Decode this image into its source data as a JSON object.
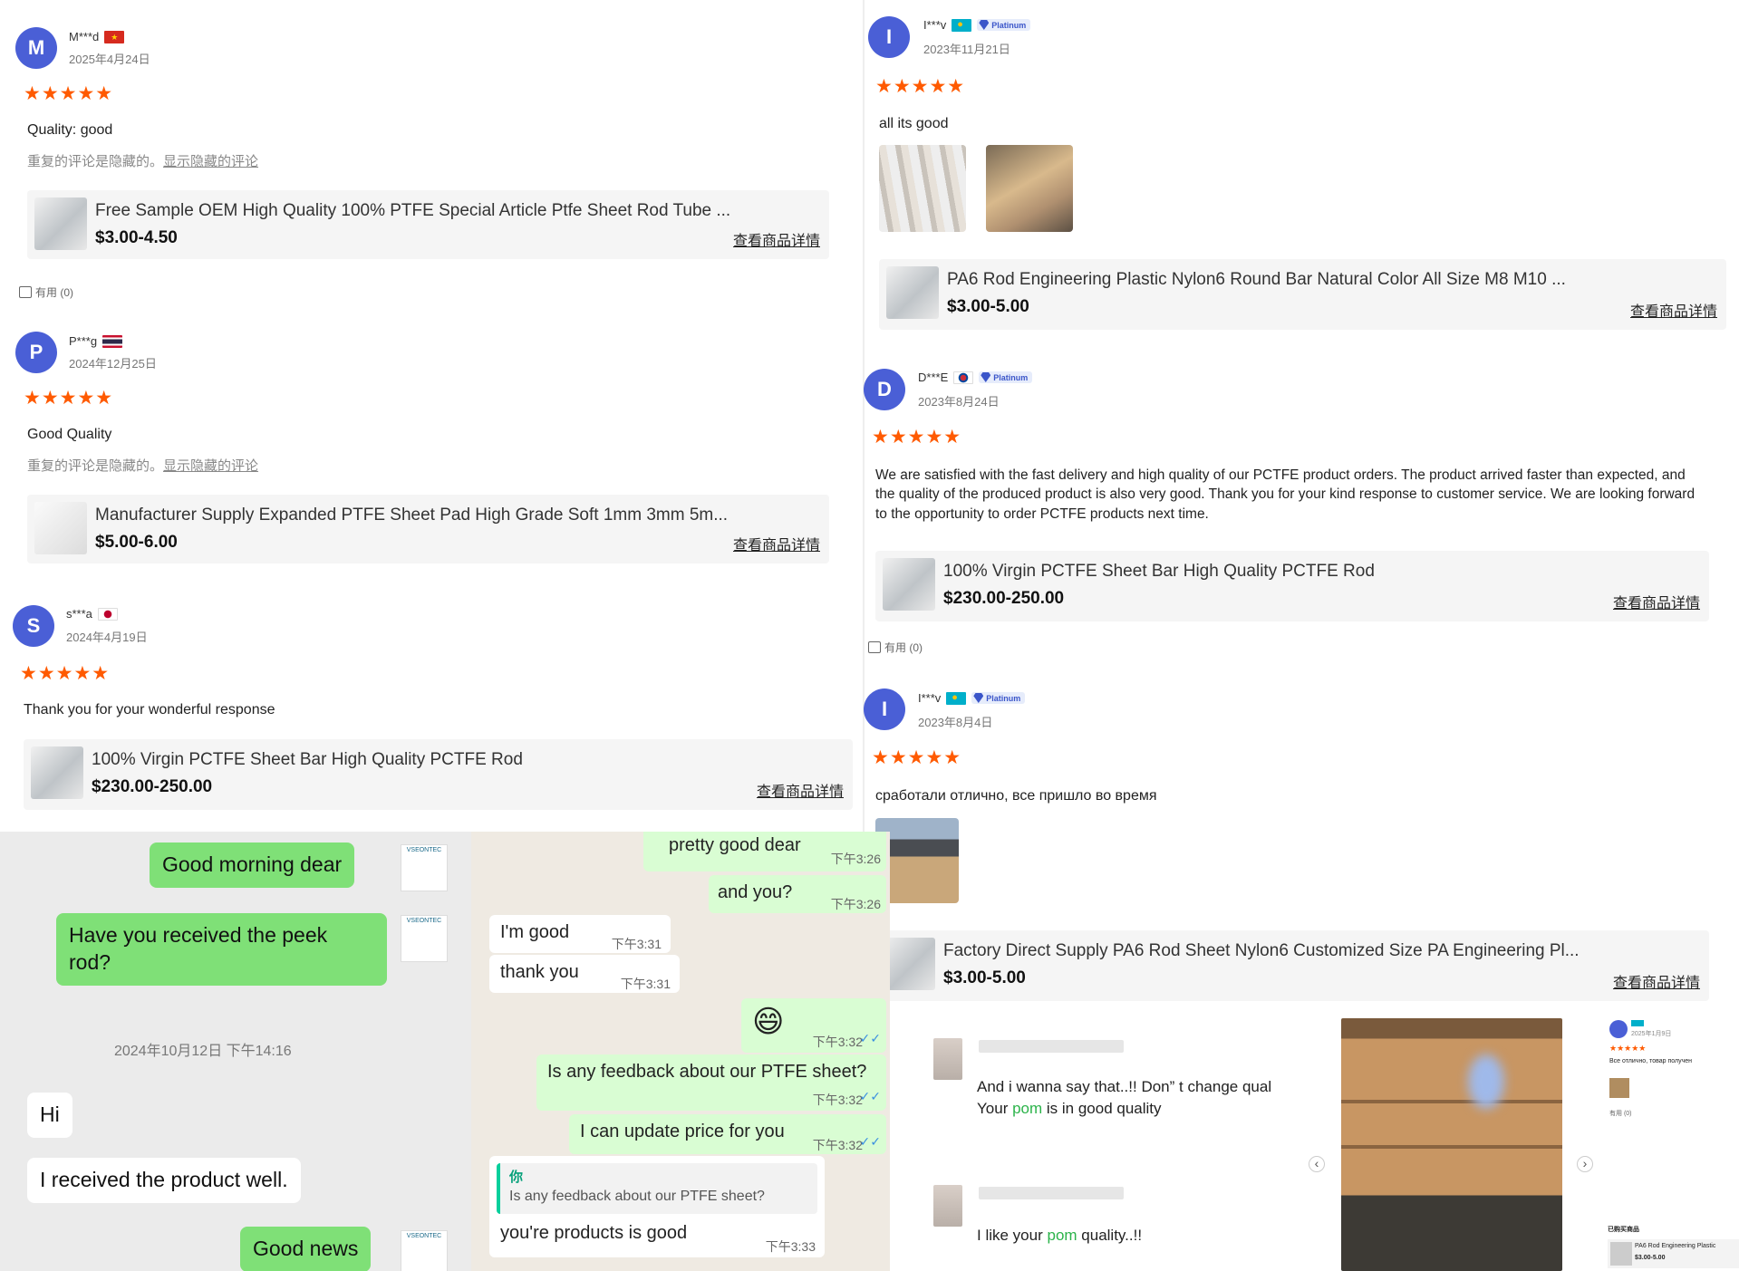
{
  "left_reviews": [
    {
      "initial": "M",
      "user": "M***d",
      "flag": "flag-vietnam",
      "date": "2025年4月24日",
      "stars": "★★★★★",
      "text": "Quality: good",
      "hidden_note": "重复的评论是隐藏的。",
      "hidden_link": "显示隐藏的评论",
      "product": {
        "title": "Free Sample OEM High Quality 100% PTFE Special Article Ptfe Sheet Rod Tube ...",
        "price": "$3.00-4.50",
        "detail": "查看商品详情"
      },
      "useful": "有用 (0)"
    },
    {
      "initial": "P",
      "user": "P***g",
      "flag": "flag-thailand",
      "date": "2024年12月25日",
      "stars": "★★★★★",
      "text": "Good Quality",
      "hidden_note": "重复的评论是隐藏的。",
      "hidden_link": "显示隐藏的评论",
      "product": {
        "title": "Manufacturer Supply Expanded PTFE Sheet Pad High Grade Soft 1mm 3mm 5m...",
        "price": "$5.00-6.00",
        "detail": "查看商品详情"
      }
    },
    {
      "initial": "S",
      "user": "s***a",
      "flag": "flag-japan",
      "date": "2024年4月19日",
      "stars": "★★★★★",
      "text": "Thank you for your wonderful response",
      "product": {
        "title": "100% Virgin PCTFE Sheet Bar High Quality PCTFE Rod",
        "price": "$230.00-250.00",
        "detail": "查看商品详情"
      }
    }
  ],
  "right_reviews": [
    {
      "initial": "I",
      "user": "I***v",
      "flag": "flag-kazakhstan",
      "badge": "Platinum",
      "date": "2023年11月21日",
      "stars": "★★★★★",
      "text": "all its good",
      "product": {
        "title": "PA6 Rod Engineering Plastic Nylon6 Round Bar Natural Color All Size M8 M10 ...",
        "price": "$3.00-5.00",
        "detail": "查看商品详情"
      }
    },
    {
      "initial": "D",
      "user": "D***E",
      "flag": "flag-south-korea",
      "badge": "Platinum",
      "date": "2023年8月24日",
      "stars": "★★★★★",
      "text": "We are satisfied with the fast delivery and high quality of our PCTFE product orders. The product arrived faster than expected, and the quality of the produced product is also very good. Thank you for your kind response to customer service. We are looking forward to the opportunity to order PCTFE products next time.",
      "product": {
        "title": "100% Virgin PCTFE Sheet Bar High Quality PCTFE Rod",
        "price": "$230.00-250.00",
        "detail": "查看商品详情"
      },
      "useful": "有用 (0)"
    },
    {
      "initial": "I",
      "user": "I***v",
      "flag": "flag-kazakhstan",
      "badge": "Platinum",
      "date": "2023年8月4日",
      "stars": "★★★★★",
      "text": "сработали отлично, все пришло во время",
      "product": {
        "title": "Factory Direct Supply PA6 Rod Sheet Nylon6 Customized Size PA Engineering Pl...",
        "price": "$3.00-5.00",
        "detail": "查看商品详情"
      }
    }
  ],
  "chat_left": {
    "msg1": "Good morning dear",
    "msg2": "Have you received the peek rod?",
    "date_divider": "2024年10月12日 下午14:16",
    "msg3": "Hi",
    "msg4": "I received the product well.",
    "msg5": "Good news"
  },
  "chat_mid": {
    "m1": "pretty good dear",
    "t1": "下午3:26",
    "m2": "and you?",
    "t2": "下午3:26",
    "m3": "I'm good",
    "t3": "下午3:31",
    "m4": "thank you",
    "t4": "下午3:31",
    "m5": "😄",
    "t5": "下午3:32",
    "m6": "Is any feedback about our PTFE sheet?",
    "t6": "下午3:32",
    "m7": "I can update price for you",
    "t7": "下午3:32",
    "quote_author": "你",
    "quote_text": "Is any feedback about our PTFE sheet?",
    "m8": "you're products is good",
    "t8": "下午3:33",
    "read_ticks": "✓✓"
  },
  "comments": {
    "c1_line1": "And i wanna say that..!! Don” t change qual",
    "c1_line2_pre": "Your ",
    "c1_line2_hl": "pom",
    "c1_line2_post": " is in good quality",
    "c2_pre": "I like your ",
    "c2_hl": "pom",
    "c2_post": " quality..!!",
    "highlight_color": "#2bb34a"
  },
  "carousel": {
    "prev": "‹",
    "next": "›"
  },
  "mini_review": {
    "date": "2025年1月9日",
    "stars": "★★★★★",
    "text": "Все отлично, товар получен",
    "useful": "有用 (0)",
    "purchased": "已购买商品",
    "product_title": "PA6 Rod Engineering Plastic",
    "product_price": "$3.00-5.00"
  },
  "colors": {
    "star": "#ff5a00",
    "avatar": "#4a5fd6",
    "bubble_green": "#7fe077",
    "chat_bg": "#efeae2"
  }
}
